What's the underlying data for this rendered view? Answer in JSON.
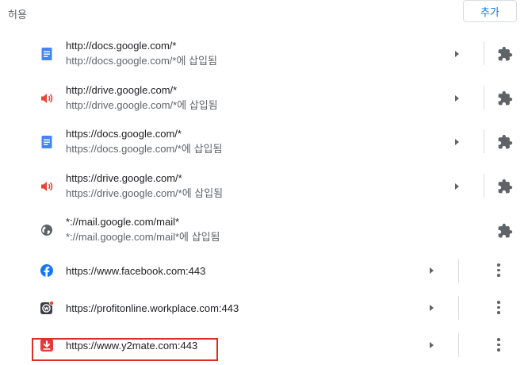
{
  "section": {
    "title": "허용",
    "add_label": "추가"
  },
  "rows": [
    {
      "primary": "http://docs.google.com/*",
      "secondary": "http://docs.google.com/*에 삽입됨",
      "icon": "docs-icon"
    },
    {
      "primary": "http://drive.google.com/*",
      "secondary": "http://drive.google.com/*에 삽입됨",
      "icon": "speaker-icon"
    },
    {
      "primary": "https://docs.google.com/*",
      "secondary": "https://docs.google.com/*에 삽입됨",
      "icon": "docs-icon"
    },
    {
      "primary": "https://drive.google.com/*",
      "secondary": "https://drive.google.com/*에 삽입됨",
      "icon": "speaker-icon"
    },
    {
      "primary": "*://mail.google.com/mail*",
      "secondary": "*://mail.google.com/mail*에 삽입됨",
      "icon": "globe-icon"
    },
    {
      "primary": "https://www.facebook.com:443",
      "icon": "facebook-icon"
    },
    {
      "primary": "https://profitonline.workplace.com:443",
      "icon": "workplace-icon"
    },
    {
      "primary": "https://www.y2mate.com:443",
      "icon": "y2mate-download-icon",
      "highlighted": true
    }
  ],
  "colors": {
    "accent": "#1a73e8",
    "docs_blue": "#4285f4",
    "speaker_red": "#ea4335",
    "facebook_blue": "#1877f2",
    "y2mate_red": "#e53935",
    "highlight_red": "#d93025"
  }
}
